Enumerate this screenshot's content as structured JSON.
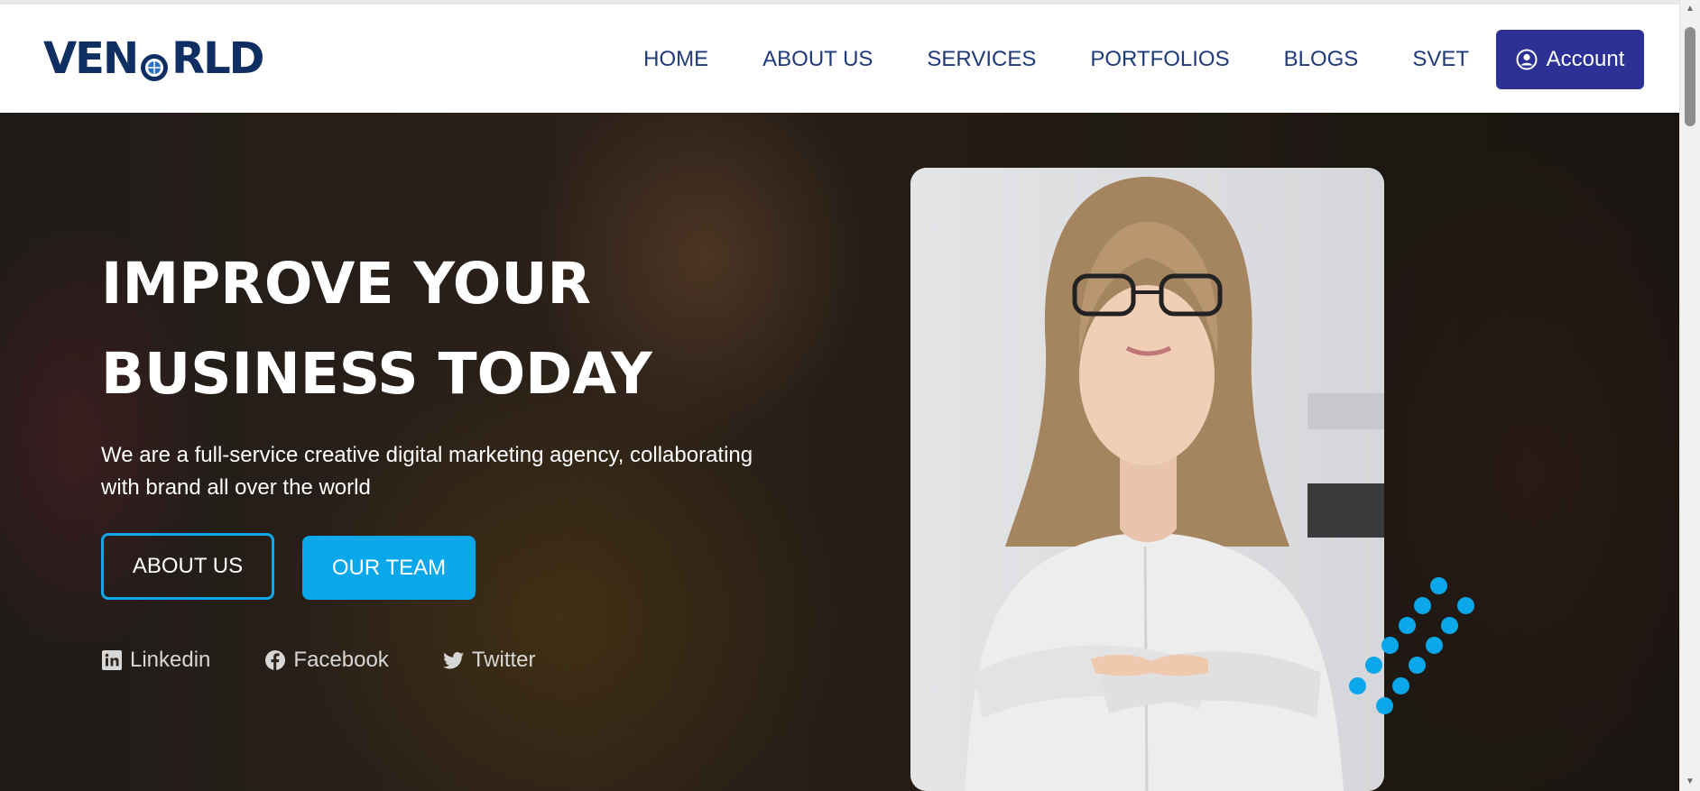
{
  "brand": {
    "logo_text_left": "VEN",
    "logo_text_right": "RLD"
  },
  "nav": {
    "items": [
      "HOME",
      "ABOUT US",
      "SERVICES",
      "PORTFOLIOS",
      "BLOGS",
      "SVET"
    ],
    "account_label": "Account"
  },
  "hero": {
    "headline_line1": "IMPROVE YOUR",
    "headline_line2": "BUSINESS TODAY",
    "subtext": "We are a full-service creative digital marketing agency, collaborating with brand all over the world",
    "buttons": {
      "about": "ABOUT US",
      "team": "OUR TEAM"
    },
    "socials": [
      {
        "label": "Linkedin",
        "icon": "linkedin-icon"
      },
      {
        "label": "Facebook",
        "icon": "facebook-icon"
      },
      {
        "label": "Twitter",
        "icon": "twitter-icon"
      }
    ]
  },
  "colors": {
    "primary_navy": "#2d3195",
    "nav_text": "#1f3a7a",
    "accent_blue": "#0aa7ea",
    "logo_navy": "#0f2f63"
  }
}
